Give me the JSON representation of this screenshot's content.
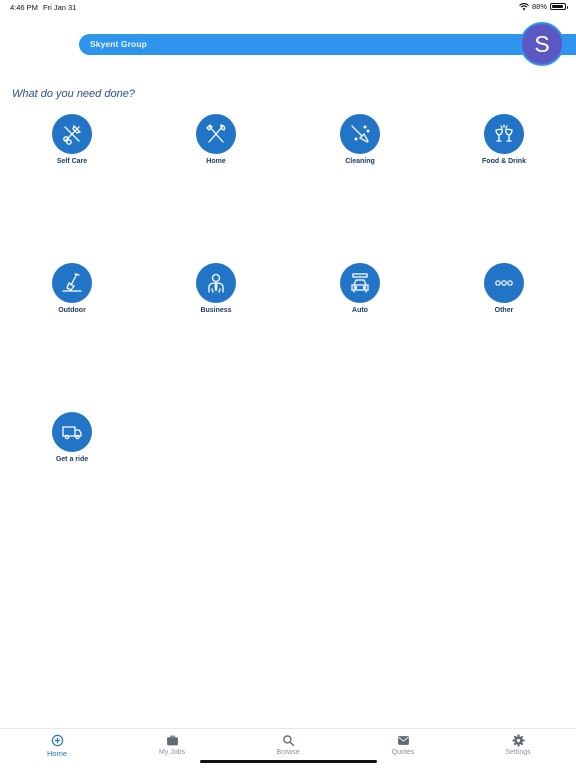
{
  "status": {
    "time": "4:46 PM",
    "date": "Fri Jan 31",
    "battery_percent": "88%",
    "battery_level": 0.88
  },
  "header": {
    "company": "Skyent Group",
    "avatar_initial": "S"
  },
  "prompt": "What do you need done?",
  "categories": [
    {
      "label": "Self Care",
      "icon": "self-care-icon"
    },
    {
      "label": "Home",
      "icon": "tools-icon"
    },
    {
      "label": "Cleaning",
      "icon": "broom-icon"
    },
    {
      "label": "Food & Drink",
      "icon": "glasses-icon"
    },
    {
      "label": "Outdoor",
      "icon": "shovel-icon"
    },
    {
      "label": "Business",
      "icon": "businessman-icon"
    },
    {
      "label": "Auto",
      "icon": "car-wash-icon"
    },
    {
      "label": "Other",
      "icon": "more-icon"
    },
    {
      "label": "Get a ride",
      "icon": "van-icon"
    }
  ],
  "tabs": [
    {
      "label": "Home",
      "icon": "plus-circle-icon",
      "active": true
    },
    {
      "label": "My Jobs",
      "icon": "briefcase-icon"
    },
    {
      "label": "Browse",
      "icon": "magnifier-icon"
    },
    {
      "label": "Quotes",
      "icon": "envelope-icon"
    },
    {
      "label": "Settings",
      "icon": "gear-icon"
    }
  ],
  "colors": {
    "accent": "#2f95ec",
    "category": "#2275c6",
    "avatar": "#5b58c4",
    "text": "#1f3b63"
  }
}
